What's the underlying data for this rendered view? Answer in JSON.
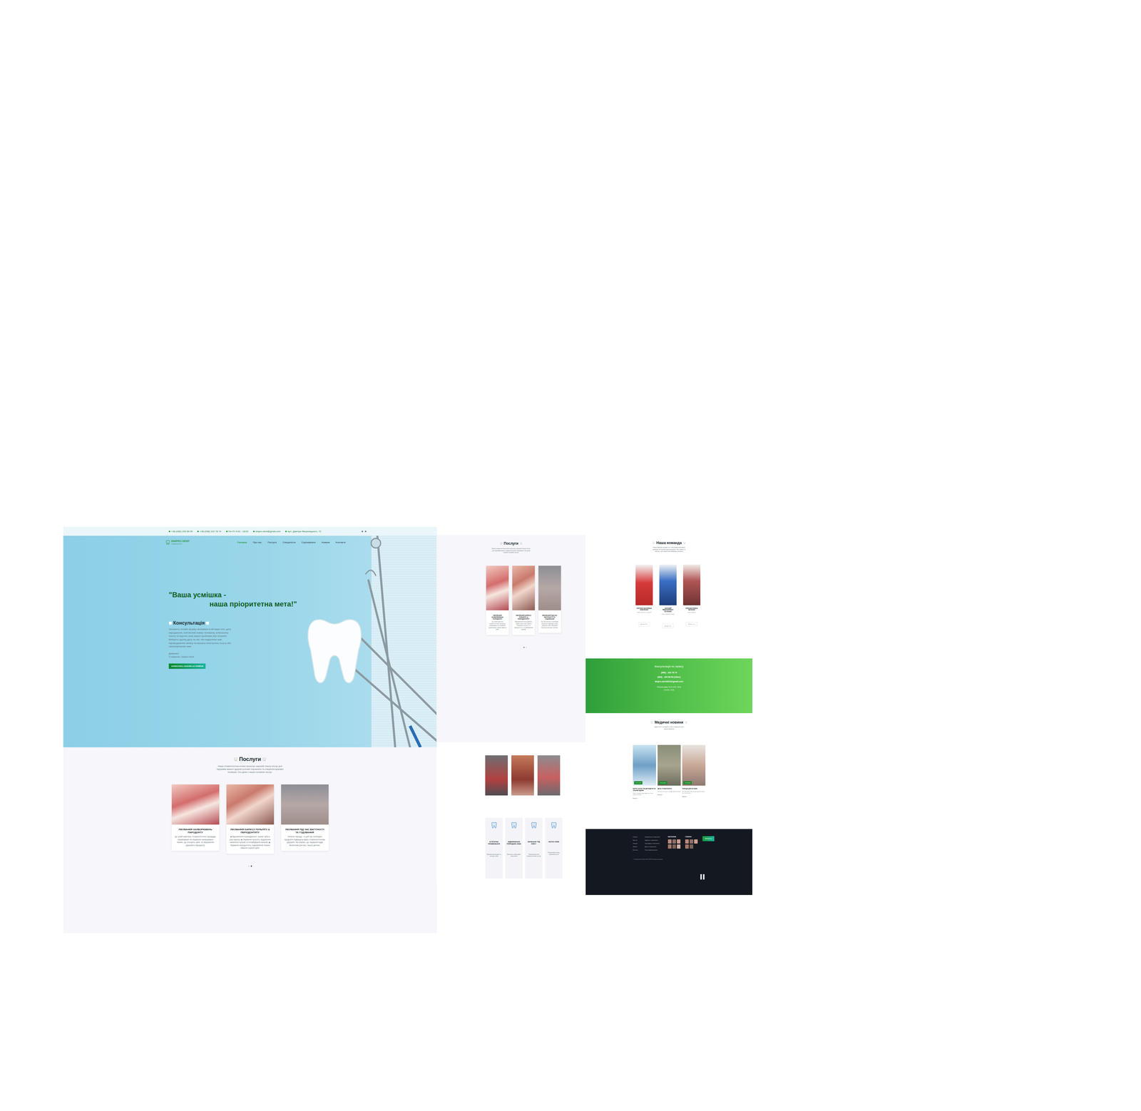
{
  "site_a": {
    "topbar": [
      "+38 (066) 209 58 99",
      "+38 (096) 102 78 74",
      "Пн-Пт 9:00 - 18:00",
      "dnipro.dent@gmail.com",
      "вул. Дмитра Яворницького, 72"
    ],
    "logo": {
      "name": "DNIPRO DENT",
      "tagline": "стоматологія"
    },
    "nav": [
      {
        "label": "Головна",
        "selected": true
      },
      {
        "label": "Про нас",
        "selected": false
      },
      {
        "label": "Послуги",
        "selected": false
      },
      {
        "label": "Спеціалісти",
        "selected": false
      },
      {
        "label": "Сертифікати",
        "selected": false
      },
      {
        "label": "Новини",
        "selected": false
      },
      {
        "label": "Контакти",
        "selected": false
      }
    ],
    "hero": {
      "title_1": "\"Ваша усмішка -",
      "title_2": "наша пріоритетна мета!\"",
      "consult_title": "Консультація",
      "text": "Заповніть онлайн форму, вказавши в ній ваше ім'я, дату народження, контактний номер телефону, електронну пошту та коротко опис вашої проблеми або потреби. Виберіть зручну дату та час. Ми надішлемо вам підтвердження запису на вказану електронну пошту або зателефонуємо вам.",
      "thanks": "Дякуємо!",
      "regards": "З повагою, Dnipro Dent",
      "button": "ЗАПИСАТИСЬ ОНЛАЙН НА ПРИЙОМ"
    },
    "services": {
      "title": "Послуги",
      "intro": "Наша стоматологічна клініка пропонує широкий спектр послуг для підтримки вашого здоров'я ротової порожнини та створення красивої посмішки. Ось деякі з наших основних послуг:",
      "cards": [
        {
          "title": "ЛІКУВАННЯ ЗАХВОРЮВАНЬ ПАРОДОНТУ",
          "text": "Це цілий комплекс стоматологічних процедур, спрямованих на лікування захворювань тканин, що оточують зуби, та збереження здорового пародонту."
        },
        {
          "title": "ЛІКУВАННЯ КАРІЄСУ ПУЛЬПІТУ & ПЕРІОДОНТИТУ",
          "text": "◆ Відновлення пошкодженого тканин зуба в разі карієсу. ◆ Лікування пульпіту: видалення запаленої пульпи та пломбування каналів. ◆ Лікування періодонтиту: відновлення тканин навколо кореня зуба."
        },
        {
          "title": "ЛІКУВАННЯ ПІД ЧАС ВАГІТНОСТІ ТА ГОДУВАННЯ",
          "text": "Початок періоду – в цей час необхідно приділяти підвищену увагу стоматологічному здоров'ю. Ми знаємо, що лікування буде безпечним для вас і вашої дитини."
        }
      ],
      "dots": [
        {
          "selected": false
        },
        {
          "selected": true
        }
      ]
    }
  },
  "site_b": {
    "services": {
      "title": "Послуги",
      "intro": "Наша стоматологічна клініка пропонує широкий спектр послуг для підтримки вашого здоров'я ротової порожнини. Ось деякі з наших основних послуг:",
      "cards": [
        {
          "title": "ЛІКУВАННЯ ЗАХВОРЮВАНЬ ПАРОДОНТУ",
          "text": "Це цілий комплекс стоматологічних процедур, спрямованих на лікування захворювань тканин навколо зубів."
        },
        {
          "title": "ЛІКУВАННЯ КАРІЄСУ ПУЛЬПІТУ & ПЕРІОДОНТИТУ",
          "text": "Відновлення пошкоджених тканин зуба в разі карієсу. Лікування пульпіту та періодонтиту з пломбуванням каналів."
        },
        {
          "title": "ЛІКУВАННЯ ПІД ЧАС ВАГІТНОСТІ ТА ГОДУВАННЯ",
          "text": "Під час вагітності необхідно приділяти підвищену увагу здоров'ю зубів. Лікування безпечне для вас і дитини."
        }
      ],
      "dots": [
        {
          "selected": true
        },
        {
          "selected": false
        }
      ]
    },
    "features": [
      {
        "title": "ЕСТЕТИЧНЕ ПЛОМБУВАННЯ",
        "text": "Відновлення форми та кольору зубів"
      },
      {
        "title": "ВІДБІЛЮВАННЯ ПРИРОДНИХ ЗУБІВ",
        "text": "Безпечне і ефективне освітлення"
      },
      {
        "title": "ЛІКУВАННЯ \"ПІД КЛЮЧ\"",
        "text": "Повний комплекс стоматологічних послуг"
      },
      {
        "title": "ЧИСТКА ЗУБІВ",
        "text": "Професійна гігієна порожнини рота"
      }
    ]
  },
  "site_c": {
    "team": {
      "title": "Наша команда",
      "intro": "Наша команда складається з висококваліфікованих фахівців, які постійно вдосконалюють свої знання та навички, щоб надати вам найкращу допомогу.",
      "members": [
        {
          "name": "СВІТЛАНА ВАСИЛІВНА КОВАЛЕНКО",
          "role": "лікар-стоматолог-терапевт",
          "experience": "Досвід: 20 р."
        },
        {
          "name": "АНАТОЛІЙ МИКОЛАЙОВИЧ ПЕТРЕНКО",
          "role": "лікар-стоматолог-хірург",
          "experience": "Досвід: 15 р."
        },
        {
          "name": "ЮЛІЯ ВІКТОРІВНА МЕЛЬНИК",
          "role": "лікар-ортодонт",
          "experience": "Досвід: 10 р."
        }
      ]
    },
    "consult": {
      "title": "Консультація по запису",
      "phone_1": "(066) - 102 78 74",
      "phone_2": "(063) - 209 58 99 (Viber)",
      "email": "dnipro.dent2023@gmail.com",
      "hours_1": "Робочий графік: Пн-Пт 9:00 - 18:00",
      "hours_2": "Сб 9:00 - 15:00"
    },
    "news": {
      "title": "Медичні новини",
      "intro": "Цікаві статті та новини зі світу стоматології для наших пацієнтів",
      "items": [
        {
          "date": "12.05.2023",
          "title": "ВАРТО ЗНАТИ: ЯК ДОГЛЯДАТИ ЗА ЗУБАМИ ВДОМА",
          "text": "Прості поради щодо щоденної гігієни порожнини рота.",
          "more": "Більше »"
        },
        {
          "date": "09.04.2023",
          "title": "ДЕНЬ СТОМАТОЛОГА",
          "text": "Вітаємо всіх колег з професійним святом!",
          "more": "Більше »"
        },
        {
          "date": "27.03.2023",
          "title": "ПОРАДИ ДЛЯ БАТЬКІВ",
          "text": "Як підготувати дитину до першого візиту до стоматолога.",
          "more": "Більше »"
        }
      ]
    },
    "footer": {
      "links_1": [
        "Головна",
        "Про нас",
        "Послуги",
        "Новини",
        "Контакти"
      ],
      "links_2": [
        "Терапевтична стоматологія",
        "Хірургічна стоматологія",
        "Ортопедична стоматологія",
        "Дитяча стоматологія",
        "Гігієна порожнини рота"
      ],
      "instagram_title": "INSTAGRAM",
      "gallery_title": "ГАЛЕРЕЯ",
      "button": "Записатись",
      "copyright": "© Стоматологія Dnipro Dent 2023. Всі права захищено"
    }
  }
}
